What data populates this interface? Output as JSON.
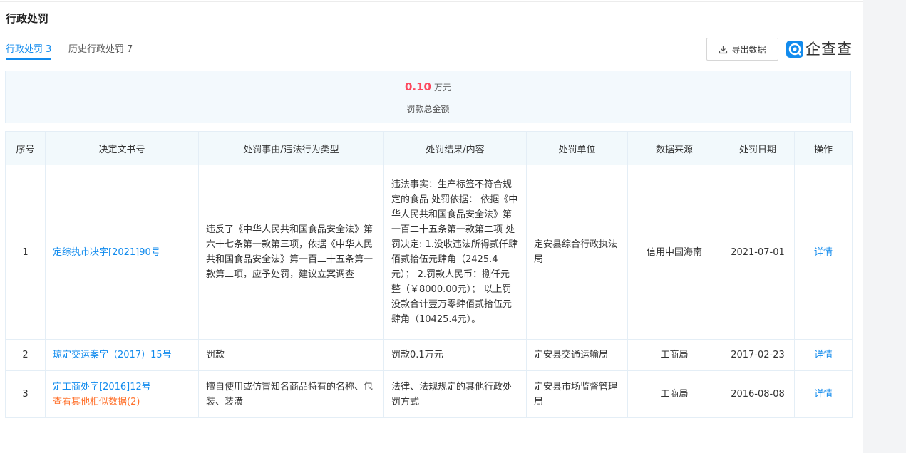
{
  "section": {
    "title": "行政处罚"
  },
  "tabs": [
    {
      "label": "行政处罚",
      "count": "3"
    },
    {
      "label": "历史行政处罚",
      "count": "7"
    }
  ],
  "toolbar": {
    "export_label": "导出数据"
  },
  "brand": {
    "logo_text": "企查查",
    "color": "#128bed"
  },
  "summary": {
    "amount": "0.10",
    "unit": "万元",
    "label": "罚款总金额",
    "amount_color": "#fd485e"
  },
  "table": {
    "headers": [
      "序号",
      "决定文书号",
      "处罚事由/违法行为类型",
      "处罚结果/内容",
      "处罚单位",
      "数据来源",
      "处罚日期",
      "操作"
    ],
    "rows": [
      {
        "index": "1",
        "doc_no": "定综执市决字[2021]90号",
        "reason": "违反了《中华人民共和国食品安全法》第六十七条第一款第三项，依据《中华人民共和国食品安全法》第一百二十五条第一款第二项，应予处罚，建议立案调查",
        "result": "违法事实：生产标签不符合规定的食品 处罚依据： 依据《中华人民共和国食品安全法》第一百二十五条第一款第二项 处罚决定: 1.没收违法所得贰仟肆佰贰拾伍元肆角（2425.4元）； 2.罚款人民币：捌仟元整（￥8000.00元）； 以上罚没款合计壹万零肆佰贰拾伍元肆角（10425.4元）。",
        "unit": "定安县综合行政执法局",
        "source": "信用中国海南",
        "date": "2021-07-01",
        "action": "详情"
      },
      {
        "index": "2",
        "doc_no": "琼定交运案字（2017）15号",
        "reason": "罚款",
        "result": "罚款0.1万元",
        "unit": "定安县交通运输局",
        "source": "工商局",
        "date": "2017-02-23",
        "action": "详情"
      },
      {
        "index": "3",
        "doc_no": "定工商处字[2016]12号",
        "similar": "查看其他相似数据(2)",
        "reason": "擅自使用或仿冒知名商品特有的名称、包装、装潢",
        "result": "法律、法规规定的其他行政处罚方式",
        "unit": "定安县市场监督管理局",
        "source": "工商局",
        "date": "2016-08-08",
        "action": "详情"
      }
    ]
  }
}
